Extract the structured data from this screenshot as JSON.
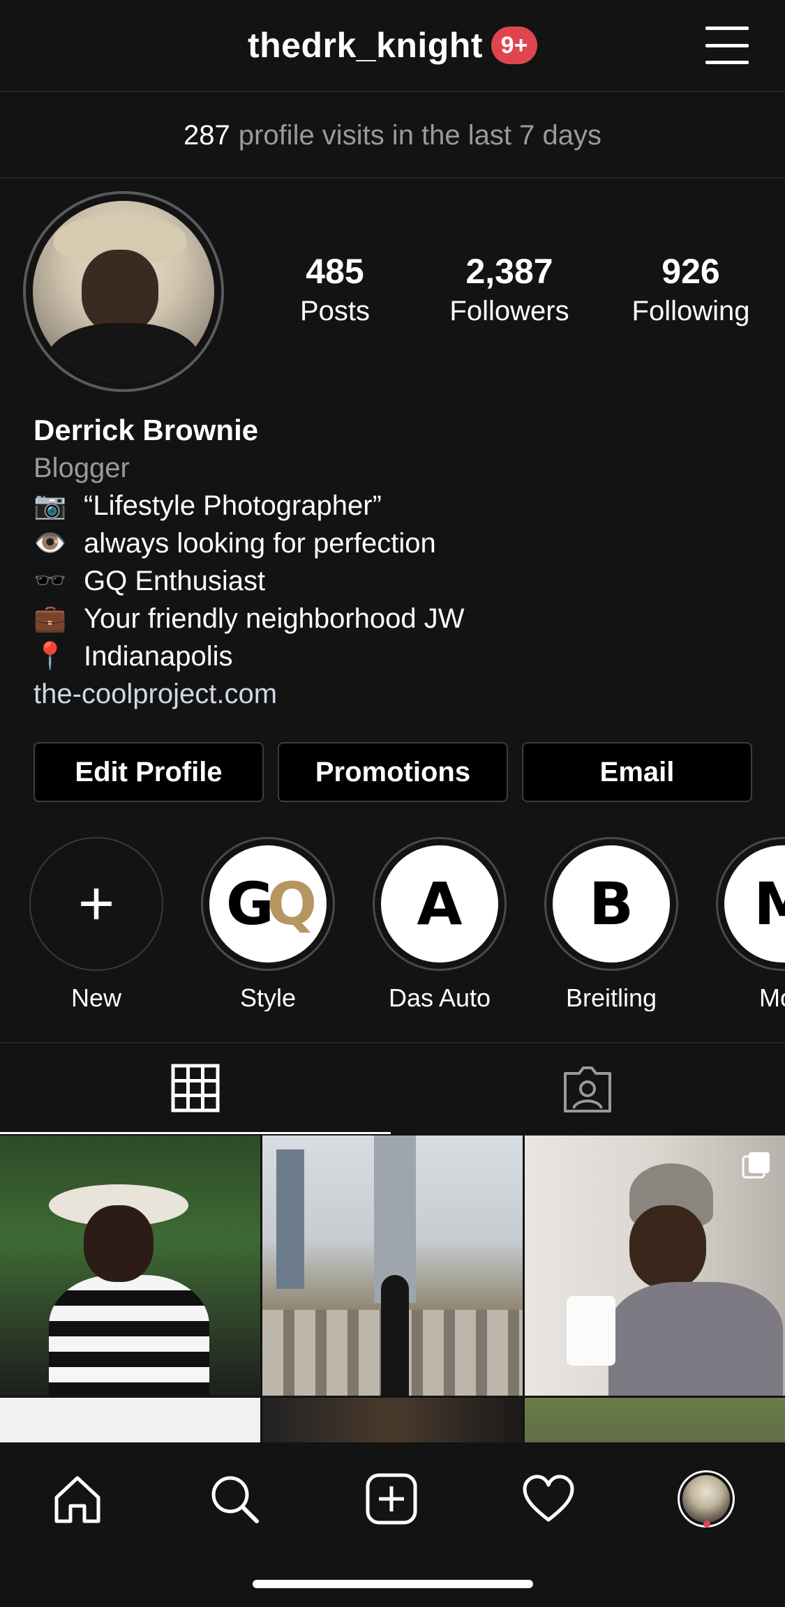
{
  "header": {
    "username": "thedrk_knight",
    "notification_badge": "9+",
    "menu_icon": "hamburger-menu-icon"
  },
  "insights": {
    "visits_count": "287",
    "visits_text": "profile visits in the last 7 days"
  },
  "profile": {
    "stats": {
      "posts_value": "485",
      "posts_label": "Posts",
      "followers_value": "2,387",
      "followers_label": "Followers",
      "following_value": "926",
      "following_label": "Following"
    },
    "name": "Derrick Brownie",
    "category": "Blogger",
    "bio_lines": [
      {
        "emoji": "📷",
        "text": "“Lifestyle Photographer”"
      },
      {
        "emoji": "👁️",
        "text": "always looking for perfection"
      },
      {
        "emoji": "🕶️",
        "text": "GQ Enthusiast"
      },
      {
        "emoji": "💼",
        "text": "Your friendly neighborhood JW"
      },
      {
        "emoji": "📍",
        "text": "Indianapolis"
      }
    ],
    "website": "the-coolproject.com"
  },
  "actions": {
    "edit_profile": "Edit Profile",
    "promotions": "Promotions",
    "email": "Email"
  },
  "highlights": [
    {
      "label": "New",
      "mark": "+"
    },
    {
      "label": "Style",
      "mark": "GQ"
    },
    {
      "label": "Das Auto",
      "mark": "A"
    },
    {
      "label": "Breitling",
      "mark": "B"
    },
    {
      "label": "Mov",
      "mark": "M"
    }
  ],
  "tabs": {
    "grid_icon": "grid-icon",
    "tagged_icon": "tagged-person-icon"
  },
  "bottom_nav": {
    "home": "home-icon",
    "search": "search-icon",
    "create": "add-post-icon",
    "activity": "heart-icon",
    "profile": "profile-avatar-icon"
  },
  "colors": {
    "background": "#131313",
    "badge": "#e0454f",
    "link": "#cfd8e6",
    "muted": "#9a9a9a"
  }
}
